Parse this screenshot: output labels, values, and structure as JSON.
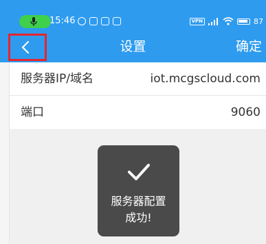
{
  "statusbar": {
    "time": "15:46",
    "vpn_label": "VPN",
    "battery": "87"
  },
  "header": {
    "title": "设置",
    "confirm_label": "确定",
    "back_icon": "chevron-left-icon",
    "background_color": "#2e9bef",
    "highlight_color": "#e8242c"
  },
  "settings": {
    "rows": [
      {
        "label": "服务器IP/域名",
        "value": "iot.mcgscloud.com"
      },
      {
        "label": "端口",
        "value": "9060"
      }
    ]
  },
  "toast": {
    "icon": "checkmark-icon",
    "line1": "服务器配置",
    "line2": "成功!"
  }
}
